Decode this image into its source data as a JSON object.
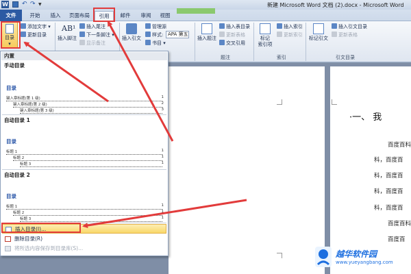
{
  "window": {
    "title": "新建 Microsoft Word 文档 (2).docx - Microsoft Word",
    "app_icon": "W"
  },
  "tabs": [
    {
      "label": "文件"
    },
    {
      "label": "开始"
    },
    {
      "label": "插入"
    },
    {
      "label": "页面布局"
    },
    {
      "label": "引用"
    },
    {
      "label": "邮件"
    },
    {
      "label": "审阅"
    },
    {
      "label": "视图"
    }
  ],
  "ribbon": {
    "toc": {
      "label": "目录",
      "add_text": "添加文字",
      "update": "更新目录"
    },
    "footnotes": {
      "insert_footnote": "插入脚注",
      "insert_endnote": "插入尾注",
      "next_footnote": "下一条脚注",
      "show_notes": "显示备注"
    },
    "citations": {
      "insert_citation": "插入引文",
      "manage_sources": "管理源",
      "style_label": "样式:",
      "style_value": "APA 第五",
      "bibliography": "书目"
    },
    "captions": {
      "insert_caption": "插入题注",
      "insert_table_of_figures": "插入表目录",
      "update_table": "更新表格",
      "cross_reference": "交叉引用",
      "group": "题注"
    },
    "index": {
      "mark_entry": "标记",
      "mark_entry_2": "索引项",
      "insert_index": "插入索引",
      "update_index": "更新索引",
      "group": "索引"
    },
    "authorities": {
      "mark_citation": "标记引文",
      "insert_toa": "插入引文目录",
      "update_table": "更新表格",
      "group": "引文目录"
    },
    "group_labels": {
      "toc": "目录",
      "footnotes": "脚注",
      "citations": "引文与书目"
    }
  },
  "menu": {
    "header": "内置",
    "gallery": [
      {
        "name": "手动目录",
        "title": "目录",
        "entries": [
          {
            "text": "键入章标题(第 1 级)",
            "num": "1"
          },
          {
            "text": "键入章标题(第 2 级)",
            "num": "2"
          },
          {
            "text": "键入章标题(第 3 级)",
            "num": "3"
          }
        ]
      },
      {
        "name": "自动目录 1",
        "title": "目录",
        "entries": [
          {
            "text": "标题 1",
            "num": "1"
          },
          {
            "text": "标题 2",
            "num": "1"
          },
          {
            "text": "标题 3",
            "num": "1"
          }
        ]
      },
      {
        "name": "自动目录 2",
        "title": "目录",
        "entries": [
          {
            "text": "标题 1",
            "num": "1"
          },
          {
            "text": "标题 2",
            "num": "1"
          },
          {
            "text": "标题 3",
            "num": "1"
          }
        ]
      }
    ],
    "commands": {
      "insert_toc": "插入目录(I)...",
      "remove_toc": "删除目录(R)",
      "save_selection": "将所选内容保存到目录库(S)..."
    }
  },
  "document": {
    "heading": "·一、 我",
    "lines": [
      "百度百科",
      "科，百度百",
      "科，百度百",
      "科，百度百",
      "科，百度百",
      "百度百科",
      "百度百"
    ]
  },
  "watermark": {
    "name": "越华软件园",
    "url": "www.yueyangbang.com"
  },
  "colors": {
    "highlight": "#e23b3b",
    "file_tab": "#2c5aa3",
    "hover": "#f9d768",
    "watermark": "#1d6fe0"
  }
}
